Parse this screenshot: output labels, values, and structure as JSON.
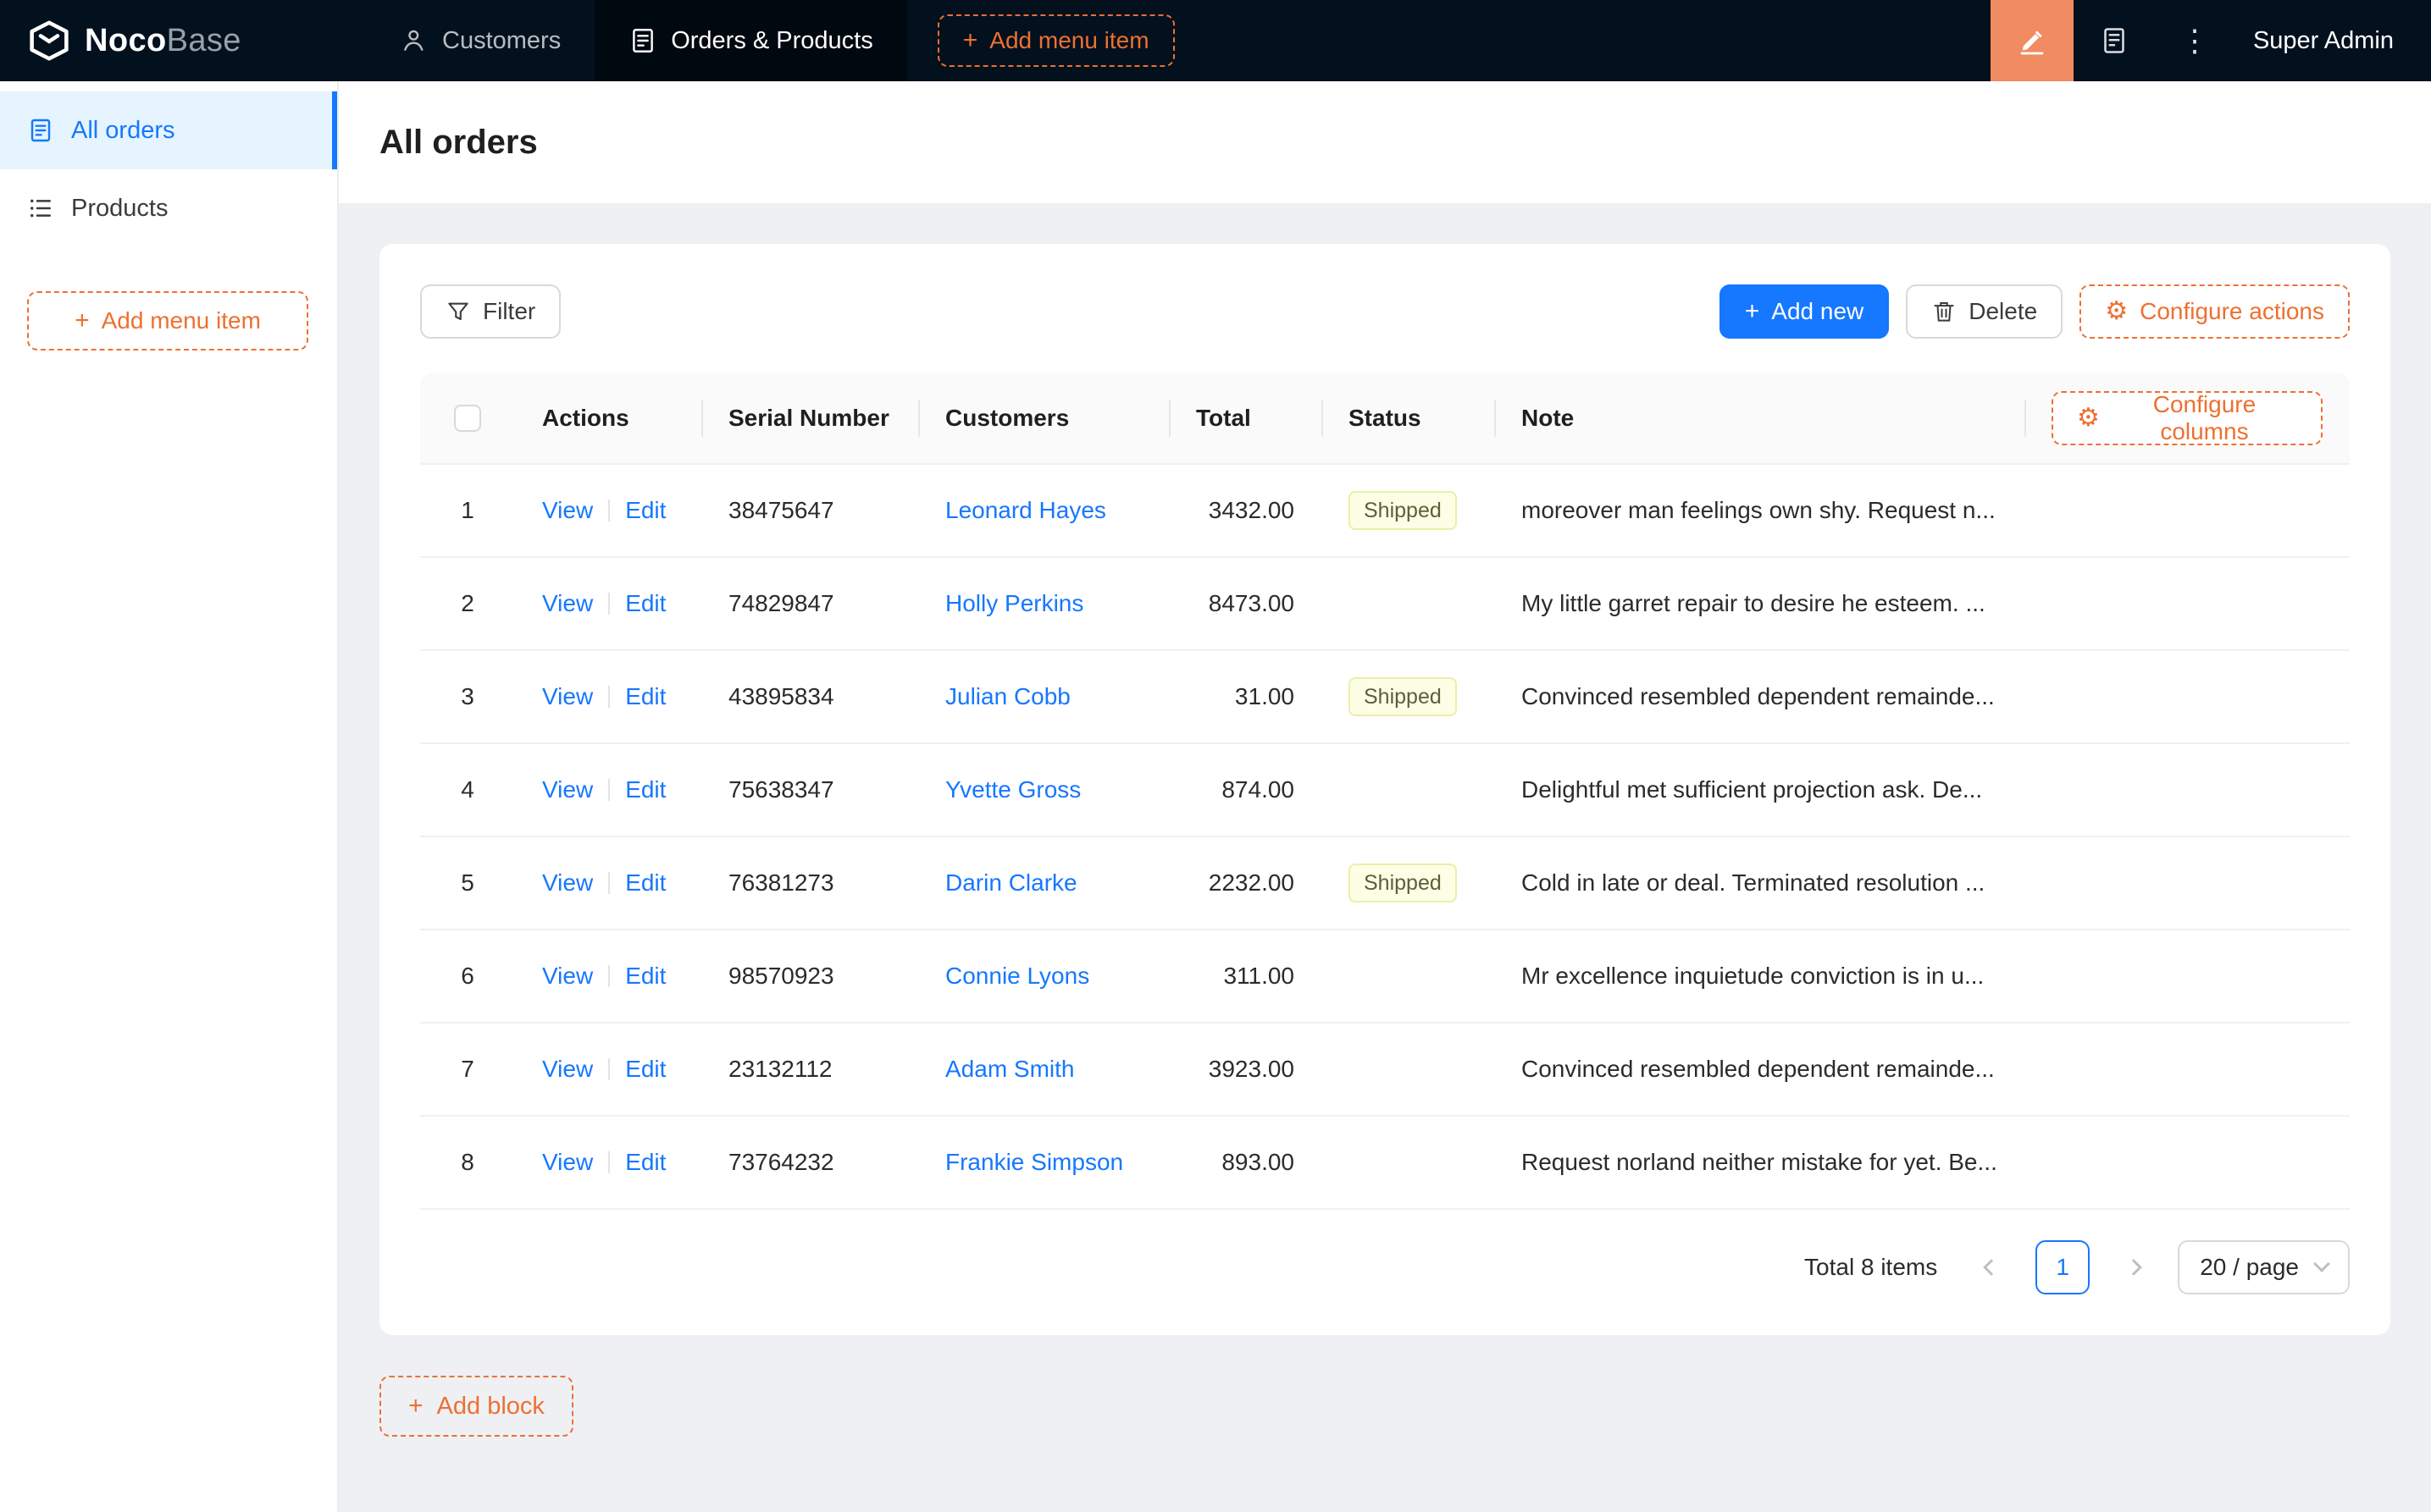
{
  "navbar": {
    "logo_noco": "Noco",
    "logo_base": "Base",
    "items": [
      {
        "label": "Customers"
      },
      {
        "label": "Orders & Products"
      }
    ],
    "add_menu_item_label": "Add menu item",
    "user": "Super Admin"
  },
  "sidebar": {
    "items": [
      {
        "label": "All orders"
      },
      {
        "label": "Products"
      }
    ],
    "add_menu_item_label": "Add menu item"
  },
  "page": {
    "title": "All orders"
  },
  "toolbar": {
    "filter_label": "Filter",
    "add_new_label": "Add new",
    "delete_label": "Delete",
    "configure_actions_label": "Configure actions"
  },
  "table": {
    "headers": {
      "actions": "Actions",
      "serial": "Serial Number",
      "customers": "Customers",
      "total": "Total",
      "status": "Status",
      "note": "Note"
    },
    "configure_columns_label": "Configure columns",
    "view_label": "View",
    "edit_label": "Edit",
    "rows": [
      {
        "index": "1",
        "serial": "38475647",
        "customer": "Leonard Hayes",
        "total": "3432.00",
        "status": "Shipped",
        "note": "moreover man feelings own shy. Request n..."
      },
      {
        "index": "2",
        "serial": "74829847",
        "customer": "Holly Perkins",
        "total": "8473.00",
        "status": "",
        "note": "My little garret repair to desire he esteem. ..."
      },
      {
        "index": "3",
        "serial": "43895834",
        "customer": "Julian Cobb",
        "total": "31.00",
        "status": "Shipped",
        "note": "Convinced resembled dependent remainde..."
      },
      {
        "index": "4",
        "serial": "75638347",
        "customer": "Yvette Gross",
        "total": "874.00",
        "status": "",
        "note": "Delightful met sufficient projection ask. De..."
      },
      {
        "index": "5",
        "serial": "76381273",
        "customer": "Darin Clarke",
        "total": "2232.00",
        "status": "Shipped",
        "note": "Cold in late or deal. Terminated resolution ..."
      },
      {
        "index": "6",
        "serial": "98570923",
        "customer": "Connie Lyons",
        "total": "311.00",
        "status": "",
        "note": "Mr excellence inquietude conviction is in u..."
      },
      {
        "index": "7",
        "serial": "23132112",
        "customer": "Adam Smith",
        "total": "3923.00",
        "status": "",
        "note": "Convinced resembled dependent remainde..."
      },
      {
        "index": "8",
        "serial": "73764232",
        "customer": "Frankie Simpson",
        "total": "893.00",
        "status": "",
        "note": "Request norland neither mistake for yet. Be..."
      }
    ]
  },
  "pagination": {
    "total_label": "Total 8 items",
    "page_number": "1",
    "page_size_label": "20 / page"
  },
  "add_block_label": "Add block",
  "colors": {
    "navbar_bg": "#03101e",
    "primary_blue": "#1677ff",
    "designable_orange": "#ed7031",
    "designable_toggle_bg": "#f18b62",
    "active_sidebar_bg": "#e6f4ff",
    "status_tag_bg": "#fcffe6",
    "content_bg": "#eef0f4"
  }
}
